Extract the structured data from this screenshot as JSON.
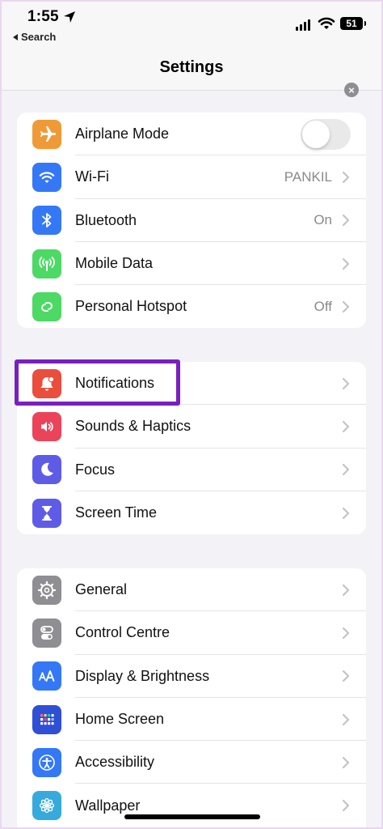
{
  "status_bar": {
    "time": "1:55",
    "back_label": "Search",
    "battery": "51"
  },
  "nav": {
    "title": "Settings",
    "close_glyph": "×"
  },
  "groups": [
    {
      "rows": [
        {
          "label": "Airplane Mode",
          "icon": "airplane-icon",
          "color": "#f09a37",
          "control": "toggle",
          "toggle_on": false
        },
        {
          "label": "Wi-Fi",
          "icon": "wifi-icon",
          "color": "#3478f6",
          "value": "PANKIL"
        },
        {
          "label": "Bluetooth",
          "icon": "bluetooth-icon",
          "color": "#3478f6",
          "value": "On"
        },
        {
          "label": "Mobile Data",
          "icon": "antenna-icon",
          "color": "#4cd964",
          "value": ""
        },
        {
          "label": "Personal Hotspot",
          "icon": "hotspot-icon",
          "color": "#4cd964",
          "value": "Off"
        }
      ]
    },
    {
      "rows": [
        {
          "label": "Notifications",
          "icon": "bell-icon",
          "color": "#eb4d3d",
          "highlighted": true
        },
        {
          "label": "Sounds & Haptics",
          "icon": "speaker-icon",
          "color": "#eb445a"
        },
        {
          "label": "Focus",
          "icon": "moon-icon",
          "color": "#5e5ce6"
        },
        {
          "label": "Screen Time",
          "icon": "hourglass-icon",
          "color": "#5e5ce6"
        }
      ]
    },
    {
      "rows": [
        {
          "label": "General",
          "icon": "gear-icon",
          "color": "#8e8e93"
        },
        {
          "label": "Control Centre",
          "icon": "switches-icon",
          "color": "#8e8e93"
        },
        {
          "label": "Display & Brightness",
          "icon": "text-size-icon",
          "color": "#3478f6"
        },
        {
          "label": "Home Screen",
          "icon": "app-grid-icon",
          "color": "#2f4fd6"
        },
        {
          "label": "Accessibility",
          "icon": "accessibility-icon",
          "color": "#3478f6"
        },
        {
          "label": "Wallpaper",
          "icon": "flower-icon",
          "color": "#36aadc"
        }
      ]
    }
  ]
}
